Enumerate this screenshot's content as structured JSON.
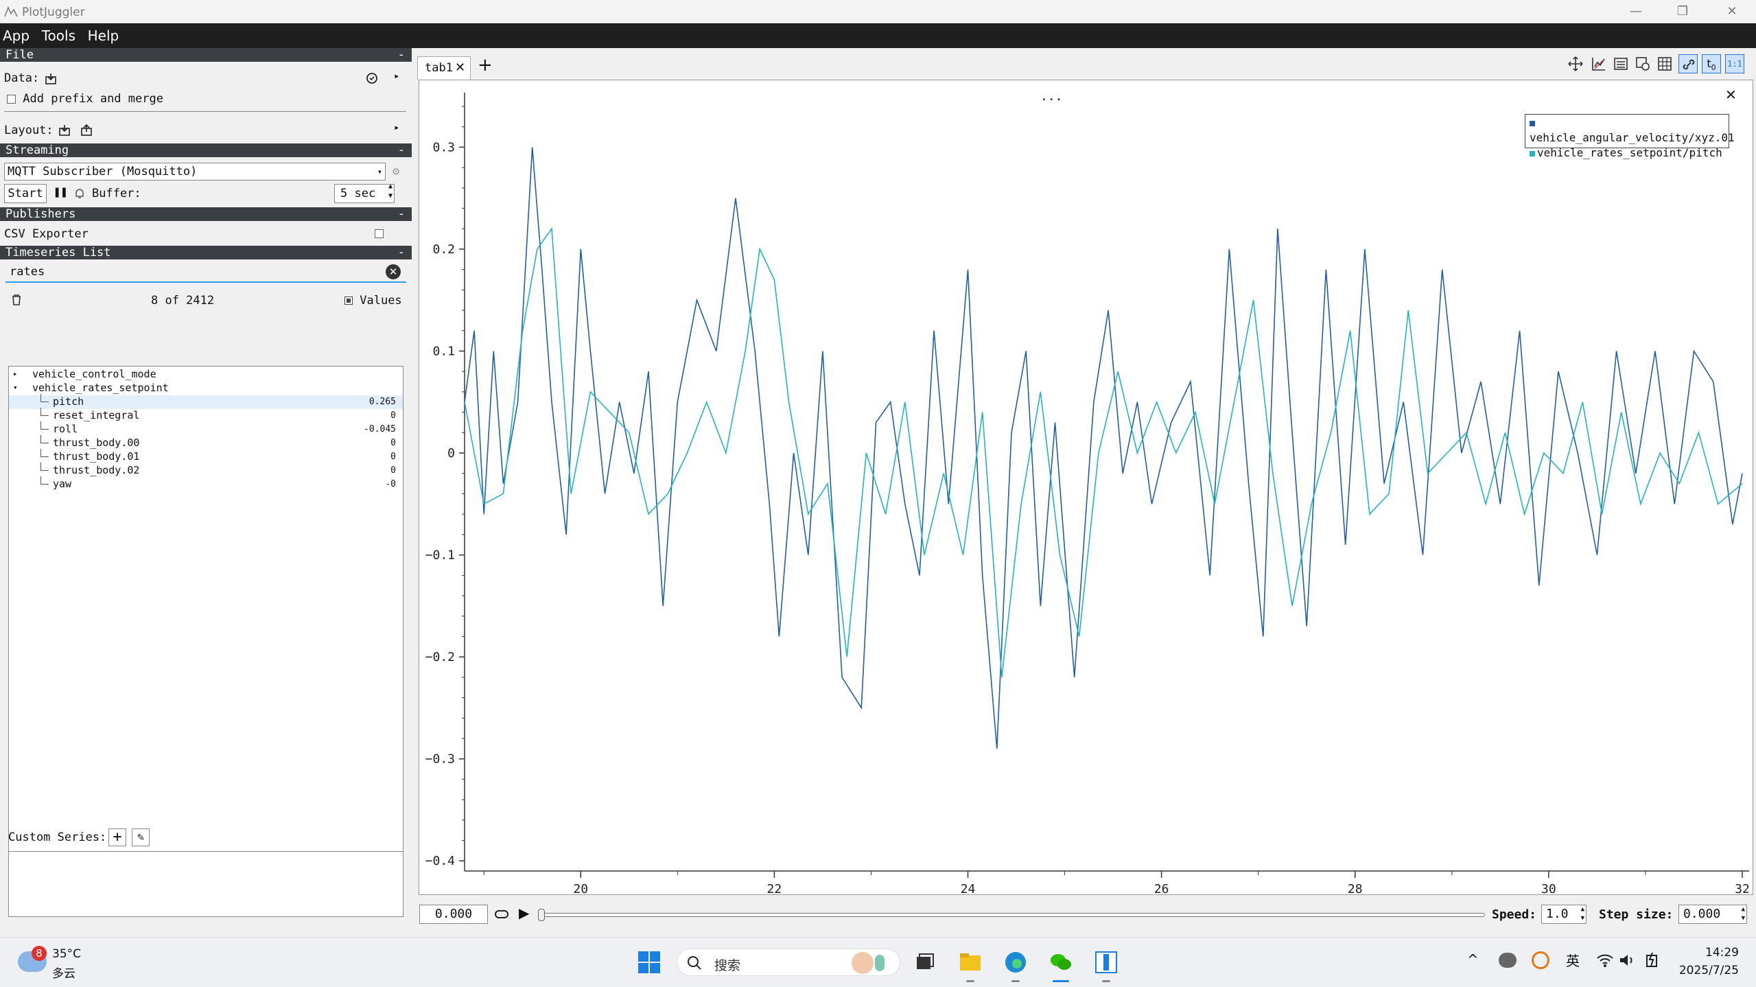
{
  "window": {
    "title": "PlotJuggler"
  },
  "menu": [
    "App",
    "Tools",
    "Help"
  ],
  "sections": {
    "file": "File",
    "streaming": "Streaming",
    "publishers": "Publishers",
    "timeseries": "Timeseries List"
  },
  "file": {
    "data_label": "Data:",
    "prefix_label": "Add prefix and merge",
    "layout_label": "Layout:"
  },
  "streaming": {
    "source": "MQTT Subscriber (Mosquitto)",
    "start_label": "Start",
    "buffer_label": "Buffer:",
    "buffer_value": "5 sec"
  },
  "publishers": {
    "csv_label": "CSV Exporter"
  },
  "timeseries": {
    "filter": "rates",
    "count": "8 of 2412",
    "values_label": "Values"
  },
  "tree": [
    {
      "label": "vehicle_control_mode",
      "value": "",
      "level": 0,
      "arrow": "right"
    },
    {
      "label": "vehicle_rates_setpoint",
      "value": "",
      "level": 0,
      "arrow": "down"
    },
    {
      "label": "pitch",
      "value": "0.265",
      "level": 1,
      "selected": true
    },
    {
      "label": "reset_integral",
      "value": "0",
      "level": 1
    },
    {
      "label": "roll",
      "value": "-0.045",
      "level": 1
    },
    {
      "label": "thrust_body.00",
      "value": "0",
      "level": 1
    },
    {
      "label": "thrust_body.01",
      "value": "0",
      "level": 1
    },
    {
      "label": "thrust_body.02",
      "value": "0",
      "level": 1
    },
    {
      "label": "yaw",
      "value": "-0",
      "level": 1
    }
  ],
  "custom_series_label": "Custom Series:",
  "tab": {
    "name": "tab1",
    "add": "+"
  },
  "plot": {
    "dots": "..."
  },
  "chart_data": {
    "type": "line",
    "title": "",
    "xlabel": "",
    "ylabel": "",
    "xlim": [
      18.8,
      32.0
    ],
    "ylim": [
      -0.41,
      0.34
    ],
    "x_ticks": [
      20,
      22,
      24,
      26,
      28,
      30,
      32
    ],
    "y_ticks": [
      0.3,
      0.2,
      0.1,
      0,
      -0.1,
      -0.2,
      -0.3,
      -0.4
    ],
    "y_tick_labels": [
      "0.3",
      "0.2",
      "0.1",
      "0",
      "−0.1",
      "−0.2",
      "−0.3",
      "−0.4"
    ],
    "grid": false,
    "legend": "top-right",
    "series": [
      {
        "name": "vehicle_angular_velocity/xyz.01",
        "color": "#1f5fa8",
        "x": [
          18.8,
          18.9,
          19.0,
          19.1,
          19.2,
          19.35,
          19.5,
          19.6,
          19.7,
          19.85,
          20.0,
          20.1,
          20.25,
          20.4,
          20.55,
          20.7,
          20.85,
          21.0,
          21.2,
          21.4,
          21.6,
          21.8,
          21.95,
          22.05,
          22.2,
          22.35,
          22.5,
          22.7,
          22.9,
          23.05,
          23.2,
          23.35,
          23.5,
          23.65,
          23.8,
          24.0,
          24.15,
          24.3,
          24.45,
          24.6,
          24.75,
          24.9,
          25.1,
          25.3,
          25.45,
          25.6,
          25.75,
          25.9,
          26.1,
          26.3,
          26.5,
          26.7,
          26.9,
          27.05,
          27.2,
          27.35,
          27.5,
          27.7,
          27.9,
          28.1,
          28.3,
          28.5,
          28.7,
          28.9,
          29.1,
          29.3,
          29.5,
          29.7,
          29.9,
          30.1,
          30.3,
          30.5,
          30.7,
          30.9,
          31.1,
          31.3,
          31.5,
          31.7,
          31.9,
          32.0
        ],
        "y": [
          0.05,
          0.12,
          -0.06,
          0.1,
          -0.03,
          0.05,
          0.3,
          0.18,
          0.05,
          -0.08,
          0.2,
          0.1,
          -0.04,
          0.05,
          -0.02,
          0.08,
          -0.15,
          0.05,
          0.15,
          0.1,
          0.25,
          0.1,
          -0.05,
          -0.18,
          0.0,
          -0.1,
          0.1,
          -0.22,
          -0.25,
          0.03,
          0.05,
          -0.05,
          -0.12,
          0.12,
          -0.05,
          0.18,
          -0.12,
          -0.29,
          0.02,
          0.1,
          -0.15,
          0.03,
          -0.22,
          0.05,
          0.14,
          -0.02,
          0.05,
          -0.05,
          0.03,
          0.07,
          -0.12,
          0.2,
          -0.03,
          -0.18,
          0.22,
          0.02,
          -0.17,
          0.18,
          -0.09,
          0.2,
          -0.03,
          0.05,
          -0.1,
          0.18,
          0.0,
          0.07,
          -0.05,
          0.12,
          -0.13,
          0.08,
          0.0,
          -0.1,
          0.1,
          -0.02,
          0.1,
          -0.05,
          0.1,
          0.07,
          -0.07,
          -0.02
        ]
      },
      {
        "name": "vehicle_rates_setpoint/pitch",
        "color": "#22b3c6",
        "x": [
          18.8,
          19.0,
          19.2,
          19.4,
          19.55,
          19.7,
          19.9,
          20.1,
          20.3,
          20.5,
          20.7,
          20.9,
          21.1,
          21.3,
          21.5,
          21.7,
          21.85,
          22.0,
          22.15,
          22.35,
          22.55,
          22.75,
          22.95,
          23.15,
          23.35,
          23.55,
          23.75,
          23.95,
          24.15,
          24.35,
          24.55,
          24.75,
          24.95,
          25.15,
          25.35,
          25.55,
          25.75,
          25.95,
          26.15,
          26.35,
          26.55,
          26.75,
          26.95,
          27.15,
          27.35,
          27.55,
          27.75,
          27.95,
          28.15,
          28.35,
          28.55,
          28.75,
          28.95,
          29.15,
          29.35,
          29.55,
          29.75,
          29.95,
          30.15,
          30.35,
          30.55,
          30.75,
          30.95,
          31.15,
          31.35,
          31.55,
          31.75,
          32.0
        ],
        "y": [
          0.05,
          -0.05,
          -0.04,
          0.12,
          0.2,
          0.22,
          -0.04,
          0.06,
          0.04,
          0.02,
          -0.06,
          -0.04,
          0.0,
          0.05,
          0.0,
          0.1,
          0.2,
          0.17,
          0.05,
          -0.06,
          -0.03,
          -0.2,
          0.0,
          -0.06,
          0.05,
          -0.1,
          -0.02,
          -0.1,
          0.04,
          -0.22,
          -0.05,
          0.06,
          -0.1,
          -0.18,
          0.0,
          0.08,
          0.0,
          0.05,
          0.0,
          0.04,
          -0.05,
          0.05,
          0.15,
          -0.02,
          -0.15,
          -0.05,
          0.02,
          0.12,
          -0.06,
          -0.04,
          0.14,
          -0.02,
          0.0,
          0.02,
          -0.05,
          0.02,
          -0.06,
          0.0,
          -0.02,
          0.05,
          -0.06,
          0.04,
          -0.05,
          0.0,
          -0.03,
          0.02,
          -0.05,
          -0.03
        ]
      }
    ]
  },
  "bottom": {
    "time": "0.000",
    "speed_label": "Speed:",
    "speed_value": "1.0",
    "step_label": "Step size:",
    "step_value": "0.000"
  },
  "taskbar": {
    "badge": "8",
    "temp": "35°C",
    "weather": "多云",
    "search": "搜索",
    "ime": "英",
    "time": "14:29",
    "date": "2025/7/25"
  }
}
